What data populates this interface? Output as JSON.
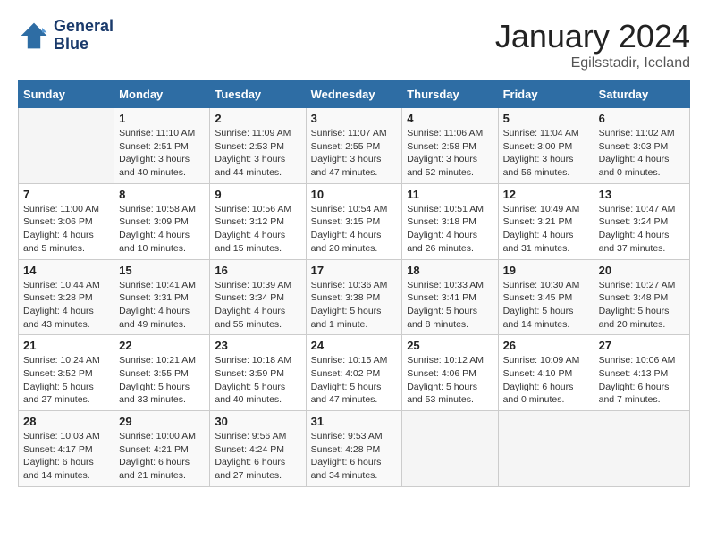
{
  "header": {
    "logo_line1": "General",
    "logo_line2": "Blue",
    "month_year": "January 2024",
    "location": "Egilsstadir, Iceland"
  },
  "weekdays": [
    "Sunday",
    "Monday",
    "Tuesday",
    "Wednesday",
    "Thursday",
    "Friday",
    "Saturday"
  ],
  "weeks": [
    [
      {
        "day": "",
        "info": ""
      },
      {
        "day": "1",
        "info": "Sunrise: 11:10 AM\nSunset: 2:51 PM\nDaylight: 3 hours\nand 40 minutes."
      },
      {
        "day": "2",
        "info": "Sunrise: 11:09 AM\nSunset: 2:53 PM\nDaylight: 3 hours\nand 44 minutes."
      },
      {
        "day": "3",
        "info": "Sunrise: 11:07 AM\nSunset: 2:55 PM\nDaylight: 3 hours\nand 47 minutes."
      },
      {
        "day": "4",
        "info": "Sunrise: 11:06 AM\nSunset: 2:58 PM\nDaylight: 3 hours\nand 52 minutes."
      },
      {
        "day": "5",
        "info": "Sunrise: 11:04 AM\nSunset: 3:00 PM\nDaylight: 3 hours\nand 56 minutes."
      },
      {
        "day": "6",
        "info": "Sunrise: 11:02 AM\nSunset: 3:03 PM\nDaylight: 4 hours\nand 0 minutes."
      }
    ],
    [
      {
        "day": "7",
        "info": "Sunrise: 11:00 AM\nSunset: 3:06 PM\nDaylight: 4 hours\nand 5 minutes."
      },
      {
        "day": "8",
        "info": "Sunrise: 10:58 AM\nSunset: 3:09 PM\nDaylight: 4 hours\nand 10 minutes."
      },
      {
        "day": "9",
        "info": "Sunrise: 10:56 AM\nSunset: 3:12 PM\nDaylight: 4 hours\nand 15 minutes."
      },
      {
        "day": "10",
        "info": "Sunrise: 10:54 AM\nSunset: 3:15 PM\nDaylight: 4 hours\nand 20 minutes."
      },
      {
        "day": "11",
        "info": "Sunrise: 10:51 AM\nSunset: 3:18 PM\nDaylight: 4 hours\nand 26 minutes."
      },
      {
        "day": "12",
        "info": "Sunrise: 10:49 AM\nSunset: 3:21 PM\nDaylight: 4 hours\nand 31 minutes."
      },
      {
        "day": "13",
        "info": "Sunrise: 10:47 AM\nSunset: 3:24 PM\nDaylight: 4 hours\nand 37 minutes."
      }
    ],
    [
      {
        "day": "14",
        "info": "Sunrise: 10:44 AM\nSunset: 3:28 PM\nDaylight: 4 hours\nand 43 minutes."
      },
      {
        "day": "15",
        "info": "Sunrise: 10:41 AM\nSunset: 3:31 PM\nDaylight: 4 hours\nand 49 minutes."
      },
      {
        "day": "16",
        "info": "Sunrise: 10:39 AM\nSunset: 3:34 PM\nDaylight: 4 hours\nand 55 minutes."
      },
      {
        "day": "17",
        "info": "Sunrise: 10:36 AM\nSunset: 3:38 PM\nDaylight: 5 hours\nand 1 minute."
      },
      {
        "day": "18",
        "info": "Sunrise: 10:33 AM\nSunset: 3:41 PM\nDaylight: 5 hours\nand 8 minutes."
      },
      {
        "day": "19",
        "info": "Sunrise: 10:30 AM\nSunset: 3:45 PM\nDaylight: 5 hours\nand 14 minutes."
      },
      {
        "day": "20",
        "info": "Sunrise: 10:27 AM\nSunset: 3:48 PM\nDaylight: 5 hours\nand 20 minutes."
      }
    ],
    [
      {
        "day": "21",
        "info": "Sunrise: 10:24 AM\nSunset: 3:52 PM\nDaylight: 5 hours\nand 27 minutes."
      },
      {
        "day": "22",
        "info": "Sunrise: 10:21 AM\nSunset: 3:55 PM\nDaylight: 5 hours\nand 33 minutes."
      },
      {
        "day": "23",
        "info": "Sunrise: 10:18 AM\nSunset: 3:59 PM\nDaylight: 5 hours\nand 40 minutes."
      },
      {
        "day": "24",
        "info": "Sunrise: 10:15 AM\nSunset: 4:02 PM\nDaylight: 5 hours\nand 47 minutes."
      },
      {
        "day": "25",
        "info": "Sunrise: 10:12 AM\nSunset: 4:06 PM\nDaylight: 5 hours\nand 53 minutes."
      },
      {
        "day": "26",
        "info": "Sunrise: 10:09 AM\nSunset: 4:10 PM\nDaylight: 6 hours\nand 0 minutes."
      },
      {
        "day": "27",
        "info": "Sunrise: 10:06 AM\nSunset: 4:13 PM\nDaylight: 6 hours\nand 7 minutes."
      }
    ],
    [
      {
        "day": "28",
        "info": "Sunrise: 10:03 AM\nSunset: 4:17 PM\nDaylight: 6 hours\nand 14 minutes."
      },
      {
        "day": "29",
        "info": "Sunrise: 10:00 AM\nSunset: 4:21 PM\nDaylight: 6 hours\nand 21 minutes."
      },
      {
        "day": "30",
        "info": "Sunrise: 9:56 AM\nSunset: 4:24 PM\nDaylight: 6 hours\nand 27 minutes."
      },
      {
        "day": "31",
        "info": "Sunrise: 9:53 AM\nSunset: 4:28 PM\nDaylight: 6 hours\nand 34 minutes."
      },
      {
        "day": "",
        "info": ""
      },
      {
        "day": "",
        "info": ""
      },
      {
        "day": "",
        "info": ""
      }
    ]
  ]
}
